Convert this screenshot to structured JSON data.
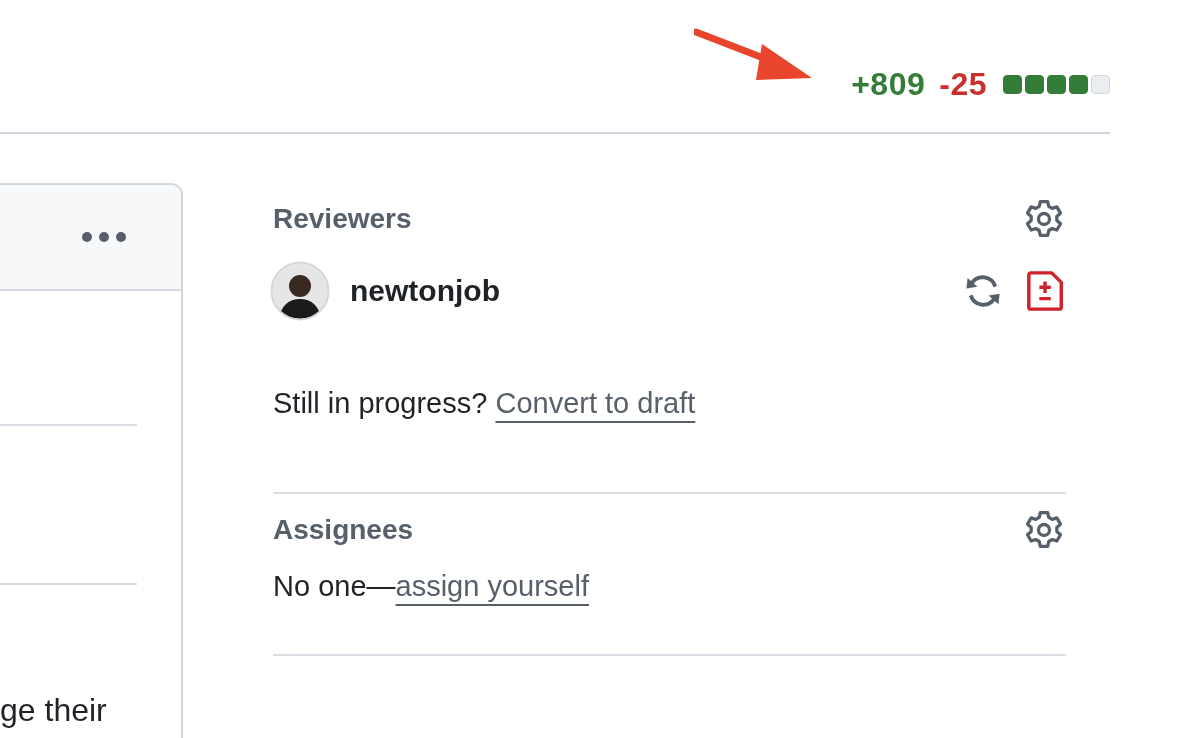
{
  "diffstat": {
    "additions": "+809",
    "deletions": "-25",
    "blocks": [
      {
        "kind": "added"
      },
      {
        "kind": "added"
      },
      {
        "kind": "added"
      },
      {
        "kind": "added"
      },
      {
        "kind": "neutral"
      }
    ]
  },
  "left_panel": {
    "text": "ge their"
  },
  "reviewers": {
    "title": "Reviewers",
    "people": [
      {
        "name": "newtonjob"
      }
    ]
  },
  "draft_prompt": {
    "text": "Still in progress?",
    "link": "Convert to draft"
  },
  "assignees": {
    "title": "Assignees",
    "text": "No one—",
    "link": "assign yourself"
  }
}
